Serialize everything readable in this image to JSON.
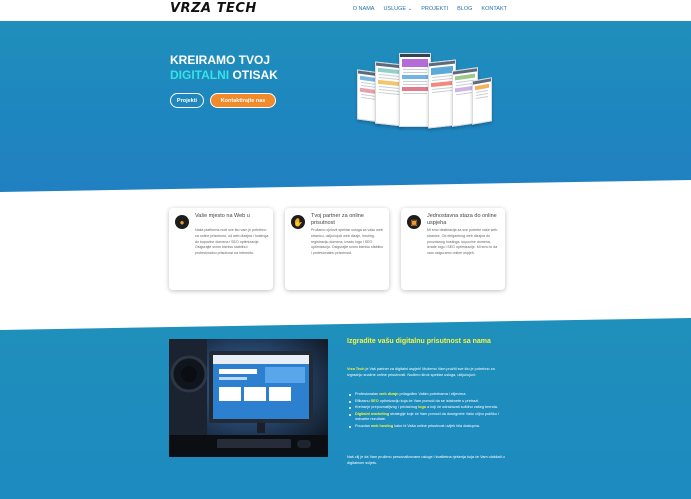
{
  "brand": {
    "logo": "VRZA TECH"
  },
  "nav": {
    "items": [
      {
        "label": "O NAMA"
      },
      {
        "label": "USLUGE ⌄"
      },
      {
        "label": "PROJEKTI"
      },
      {
        "label": "BLOG"
      },
      {
        "label": "KONTAKT"
      }
    ]
  },
  "hero": {
    "line1": "KREIRAMO TVOJ",
    "line2_accent": "DIGITALNI",
    "line2_rest": " OTISAK",
    "btn_projects": "Projekti",
    "btn_contact": "Kontaktirajte nas"
  },
  "cards": [
    {
      "icon": "lightbulb-icon",
      "title": "Vaše mjesto na Web u",
      "text": "Naša platforma nudi sve što vam je potrebno za online prisutnost, od web dizajna i hostinga do kupovine domena i SEO optimizacije. Osigurajte svom biznisu stabilnu i profesionalnu prisutnost na internetu."
    },
    {
      "icon": "handshake-icon",
      "title": "Tvoj partner za online prisutnost",
      "text": "Pružamo cjelovit spektar usluga za vašu web stranicu, uključujući web dizajn, hosting, registraciju domena, izradu logo i SEO optimizaciju. Osigurajte svom biznisu stabilnu i profesionalnu prisutnost."
    },
    {
      "icon": "document-icon",
      "title": "Jednostavna staza do online uspjeha",
      "text": "Mi smo destinacija za sve potrebe vaše web stranice. Od elegantnog web dizajna do pouzdanog hostinga, kupovine domena, izrade logo i SEO optimizacije. Mi smo tu da vam osiguramo online uspjeh."
    }
  ],
  "lower": {
    "title": "Izgradite vašu digitalnu prisutnost sa nama",
    "intro_brand": "Vrza Tech",
    "intro": " je Vaš partner za digitalni uspjeh! Možemo Vam pružiti sve što je potrebno za izgradnju snažne online prisutnosti. Nudimo širok spektar usluga, uključujući:",
    "list": [
      {
        "pre": "Profesionalan ",
        "hl": "web dizajn",
        "post": " prilagođen Vašim potrebama i ciljevima."
      },
      {
        "pre": "Efikasnu ",
        "hl": "SEO",
        "post": " optimizaciju koja će Vam pomoći da se istaknete u pretrazi."
      },
      {
        "pre": "Kreiranje prepoznatljivog i privlačnog ",
        "hl": "logo",
        "post": " a koji će odražavati suštinu vašeg brenda."
      },
      {
        "pre": "",
        "hl": "Digitalni marketing",
        "post": " strategije koje će Vam pomoći da dosegnete Vašu ciljnu publiku i ostvarite rezultate."
      },
      {
        "pre": "Pouzdan ",
        "hl": "web hosting",
        "post": " kako bi Vaša online prisutnost uvijek bila dostupna."
      }
    ],
    "outro": "Naš cilj je da Vam pružimo personalizovane usluge i kvalitetna rješenja koja će Vam olakšati u digitalnom svijetu."
  },
  "colors": {
    "hero_blue": "#1f8fbb",
    "accent_cyan": "#34e3e8",
    "contact_orange": "#f08a2a",
    "highlight_yellow": "#f5f542"
  }
}
